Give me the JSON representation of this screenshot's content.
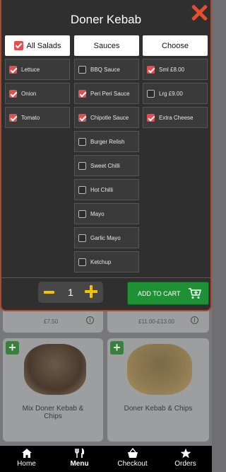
{
  "modal": {
    "title": "Doner Kebab",
    "columns": [
      {
        "header": "All Salads",
        "header_checked": true,
        "options": [
          {
            "label": "Lettuce",
            "checked": true
          },
          {
            "label": "Onion",
            "checked": true
          },
          {
            "label": "Tomato",
            "checked": true
          }
        ]
      },
      {
        "header": "Sauces",
        "options": [
          {
            "label": "BBQ Sauce",
            "checked": false
          },
          {
            "label": "Peri Peri Sauce",
            "checked": true
          },
          {
            "label": "Chipotle Sauce",
            "checked": true
          },
          {
            "label": "Burger Relish",
            "checked": false
          },
          {
            "label": "Sweet Chilli",
            "checked": false
          },
          {
            "label": "Hot Chilli",
            "checked": false
          },
          {
            "label": "Mayo",
            "checked": false
          },
          {
            "label": "Garlic Mayo",
            "checked": false
          },
          {
            "label": "Ketchup",
            "checked": false
          }
        ]
      },
      {
        "header": "Choose",
        "options": [
          {
            "label": "Sml £8.00",
            "checked": true
          },
          {
            "label": "Lrg £9.00",
            "checked": false
          },
          {
            "label": "Extra Cheese",
            "checked": true
          }
        ]
      }
    ],
    "quantity": "1",
    "add_to_cart_label": "ADD TO CART"
  },
  "background": {
    "cards": [
      {
        "price": "£7.50",
        "info": "(i)"
      },
      {
        "price": "£11.00-£13.00",
        "info": "(i)"
      },
      {
        "title": "Mix Doner Kebab & Chips"
      },
      {
        "title": "Doner Kebab & Chips"
      }
    ]
  },
  "nav": {
    "items": [
      {
        "label": "Home",
        "icon": "home-icon"
      },
      {
        "label": "Menu",
        "icon": "cutlery-icon",
        "active": true
      },
      {
        "label": "Checkout",
        "icon": "basket-icon"
      },
      {
        "label": "Orders",
        "icon": "star-icon"
      }
    ]
  },
  "colors": {
    "accent_red": "#e84d2c",
    "checkbox_red": "#e84d4d",
    "cart_green": "#1f9135",
    "qty_yellow": "#f2c400"
  }
}
